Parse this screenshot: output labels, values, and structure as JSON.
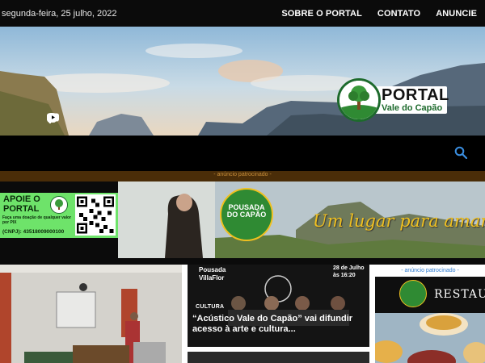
{
  "topbar": {
    "date": "segunda-feira, 25 julho, 2022",
    "nav": [
      "SOBRE O PORTAL",
      "CONTATO",
      "ANUNCIE"
    ]
  },
  "hero": {
    "logo_title": "PORTAL",
    "logo_subtitle": "Vale do Capão",
    "socials": [
      "facebook-icon",
      "instagram-icon",
      "youtube-icon"
    ]
  },
  "search": {
    "icon": "search-icon"
  },
  "sponsored": {
    "label": "- anúncio patrocinado -",
    "apoie": {
      "title": "APOIE O PORTAL",
      "text": "Faça uma doação de qualquer valor por PIX",
      "cnpj": "(CNPJ): 43518009000100"
    },
    "pousada": {
      "name_line1": "POUSADA",
      "name_line2": "DO CAPÃO",
      "tagline": "Um lugar para amar..."
    }
  },
  "content": {
    "card": {
      "corner_left": "Pousada VillaFlor",
      "corner_right": "28 de Julho às 16:20",
      "category": "CULTURA",
      "title": "“Acústico Vale do Capão” vai difundir acesso à arte e cultura..."
    },
    "side_ad": {
      "label": "- anúncio patrocinado -",
      "text": "RESTAU"
    }
  },
  "colors": {
    "accent_green": "#1d6a2c",
    "sponsored_label": "#c98f3b",
    "tagline_yellow": "#f0c020",
    "side_label_blue": "#2e7bd0"
  }
}
